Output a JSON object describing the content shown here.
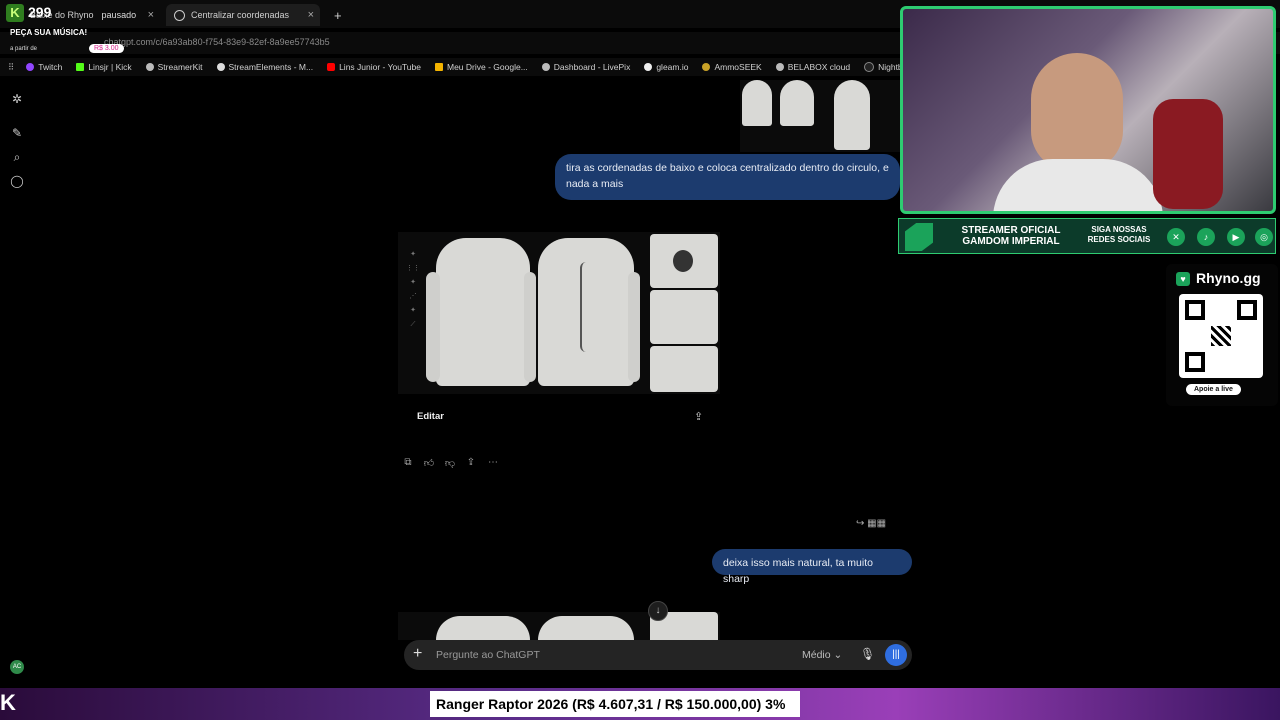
{
  "overlay": {
    "badge": "K",
    "count": "299",
    "song_request": "PEÇA SUA MÚSICA!",
    "from_label": "a partir de",
    "price": "R$ 3.00"
  },
  "browser": {
    "tab_inactive": "Baixe do Rhyno",
    "tab_inactive_status": "pausado",
    "tab_active": "Centralizar coordenadas",
    "tab_close": "×",
    "new_tab": "+",
    "url": "chatgpt.com/c/6a93ab80-f754-83e9-82ef-8a9ee57743b5",
    "bookmarks": [
      "Twitch",
      "Linsjr | Kick",
      "StreamerKit",
      "StreamElements - M...",
      "Lins Junior - YouTube",
      "Meu Drive - Google...",
      "Dashboard - LivePix",
      "gleam.io",
      "AmmoSEEK",
      "BELABOX cloud",
      "Nightbot - Comm"
    ]
  },
  "chat": {
    "message1": "tira as cordenadas de baixo e coloca centralizado dentro do circulo, e nada a mais",
    "edit_label": "Editar",
    "message2": "deixa isso mais natural, ta muito sharp",
    "composer_placeholder": "Pergunte ao ChatGPT",
    "composer_mode": "Médio",
    "avatar_initials": "AC"
  },
  "stream": {
    "banner_title": "STREAMER OFICIAL GAMDOM IMPERIAL",
    "banner_social": "SIGA NOSSAS REDES SOCIAIS",
    "rhyno_brand": "Rhyno.gg",
    "rhyno_cta": "Apoie a live",
    "ticker": "Ranger Raptor 2026 (R$ 4.607,31 / R$ 150.000,00)  3%"
  },
  "colors": {
    "user_bubble": "#1c3b6e",
    "accent_green": "#2ecc71",
    "voice_button": "#2f6ee0"
  }
}
